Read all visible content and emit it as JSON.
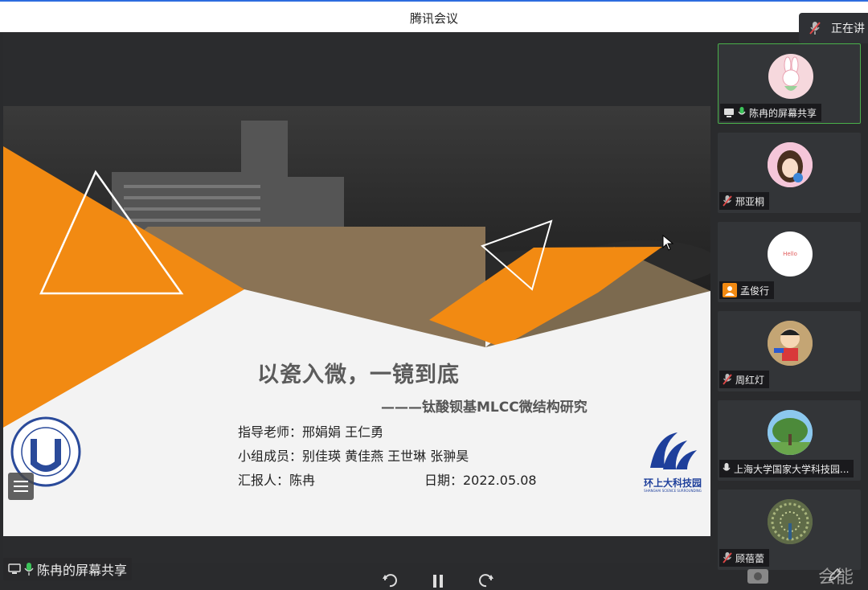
{
  "window": {
    "title": "腾讯会议"
  },
  "speaking": {
    "label": "正在讲"
  },
  "slide": {
    "title": "以瓷入微，一镜到底",
    "subtitle": "———钛酸钡基MLCC微结构研究",
    "advisor": "指导老师：邢娟娟    王仁勇",
    "members": "小组成员：别佳瑛    黄佳燕    王世琳    张翀昊",
    "reporter": "汇报人：陈冉",
    "date": "日期：2022.05.08",
    "logo_right_text": "环上大科技园",
    "logo_right_en": "SHANGHAI SCIENCE SURROUNDING",
    "logo_left_en": "SHANGHAI UNIVERSITY",
    "logo_left_cn": "上海大学"
  },
  "share_label": "陈冉的屏幕共享",
  "participants": [
    {
      "name": "陈冉的屏幕共享",
      "avatar": "rabbit-avatar",
      "status": "screen-share-mic-on",
      "active": true
    },
    {
      "name": "邢亚桐",
      "avatar": "girl-avatar",
      "status": "mic-muted"
    },
    {
      "name": "孟俊行",
      "avatar": "hello-avatar",
      "avatar_text": "Hello",
      "status": "person-icon"
    },
    {
      "name": "周红灯",
      "avatar": "cartoon-avatar",
      "status": "mic-muted"
    },
    {
      "name": "上海大学国家大学科技园...",
      "avatar": "tree-avatar",
      "status": "mic-on"
    },
    {
      "name": "顾蓓蕾",
      "avatar": "peacock-avatar",
      "status": "mic-muted"
    }
  ],
  "footer_partial": "会能",
  "colors": {
    "accent_orange": "#f28a12",
    "brown": "#8a7355",
    "active_green": "#4ab04a",
    "mic_green": "#3cc35a",
    "mute_red": "#e04848"
  }
}
